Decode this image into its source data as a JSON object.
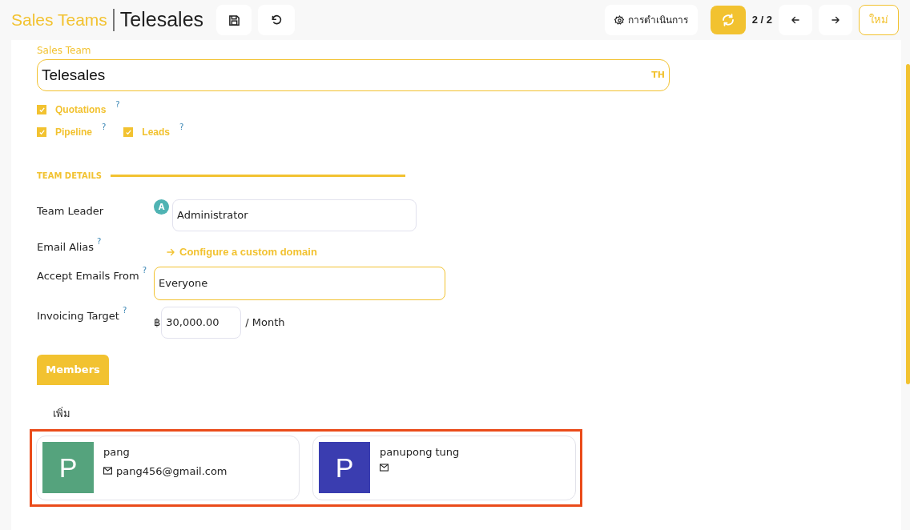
{
  "breadcrumb": {
    "parent": "Sales Teams",
    "current": "Telesales"
  },
  "toolbar": {
    "actions": "การดำเนินการ",
    "pager": "2 / 2",
    "new": "ใหม่"
  },
  "form": {
    "name_label": "Sales Team",
    "name_value": "Telesales",
    "lang": "TH",
    "options": [
      [
        {
          "label": "Quotations",
          "checked": true,
          "help": "?"
        }
      ],
      [
        {
          "label": "Pipeline",
          "checked": true,
          "help": "?"
        },
        {
          "label": "Leads",
          "checked": true,
          "help": "?"
        }
      ]
    ],
    "section": "TEAM DETAILS",
    "team_leader": {
      "label": "Team Leader",
      "avatar": "A",
      "value": "Administrator"
    },
    "email_alias": {
      "label": "Email Alias",
      "help": "?",
      "link": "Configure a custom domain"
    },
    "accept_emails": {
      "label": "Accept Emails From",
      "help": "?",
      "value": "Everyone"
    },
    "invoicing": {
      "label": "Invoicing Target",
      "help": "?",
      "currency": "฿",
      "value": "30,000.00",
      "unit": "/ Month"
    }
  },
  "tabs": [
    {
      "label": "Members",
      "selected": true
    }
  ],
  "add": "เพิ่ม",
  "members": [
    {
      "initial": "P",
      "color": "#55a37d",
      "name": "pang",
      "email": "pang456@gmail.com"
    },
    {
      "initial": "P",
      "color": "#3a3db0",
      "name": "panupong tung"
    }
  ]
}
